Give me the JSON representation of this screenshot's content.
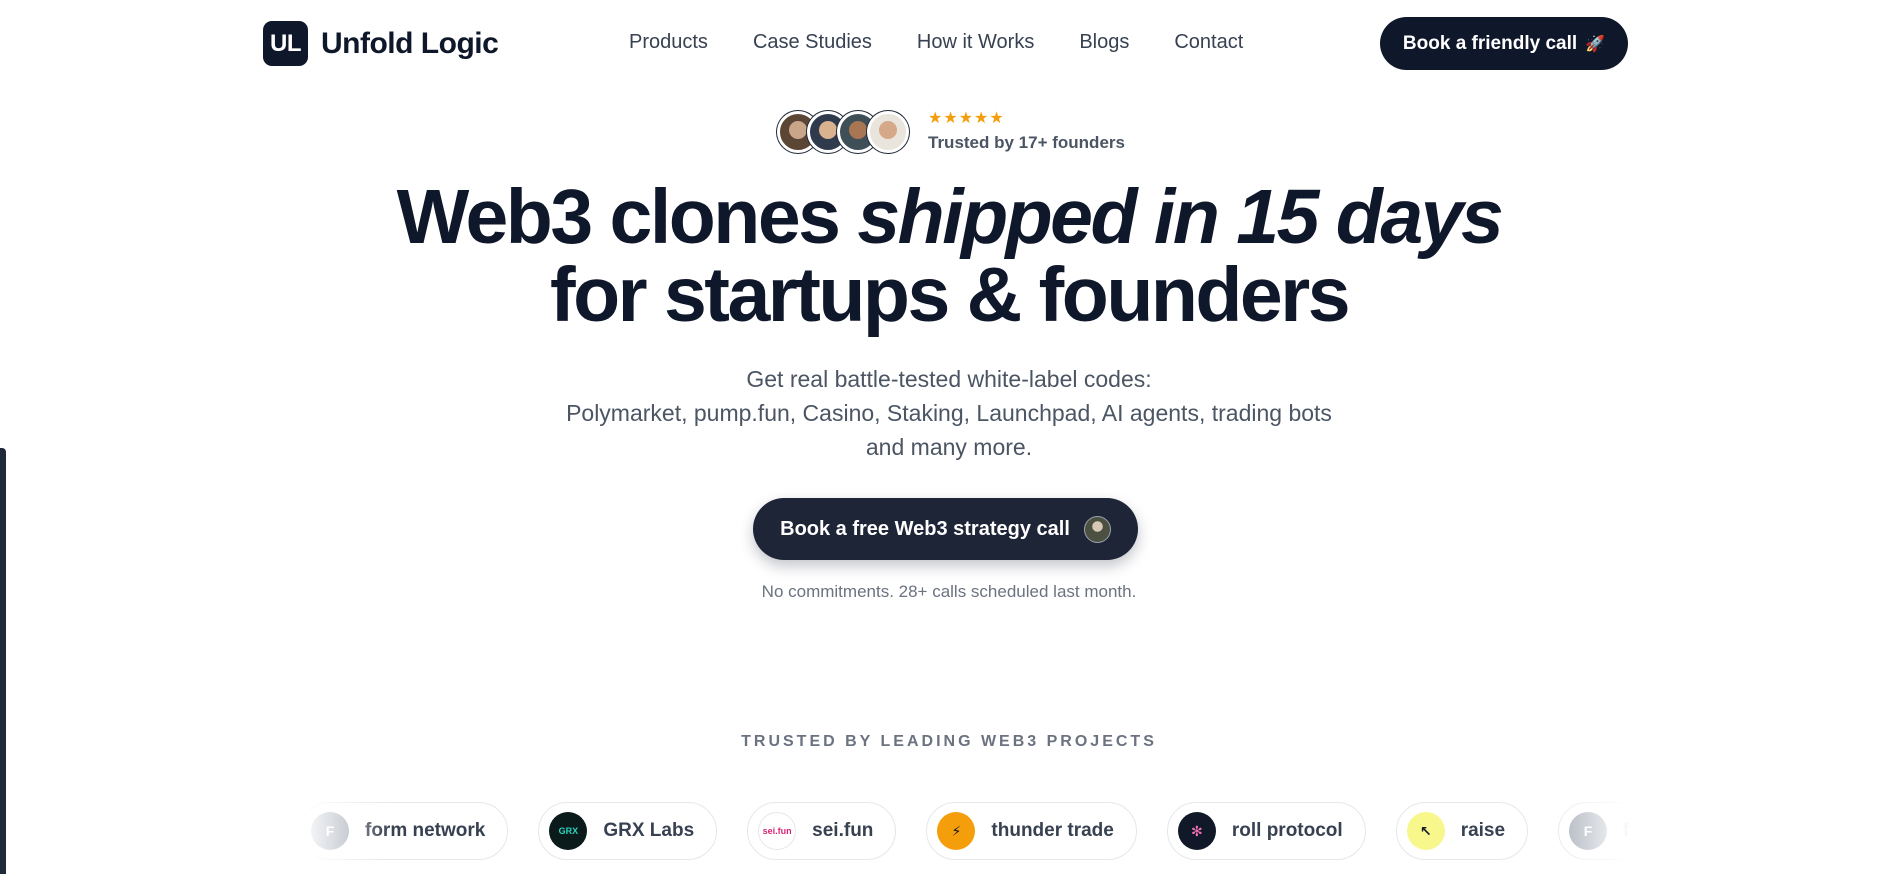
{
  "header": {
    "logo_mark": "UL",
    "brand": "Unfold Logic",
    "menu": [
      "Products",
      "Case Studies",
      "How it Works",
      "Blogs",
      "Contact"
    ],
    "cta": "Book a friendly call",
    "cta_icon": "🚀"
  },
  "trust": {
    "stars": "★★★★★",
    "label": "Trusted by 17+ founders",
    "avatar_count": 4
  },
  "hero": {
    "title_part1": "Web3 clones ",
    "title_italic": "shipped in 15 days",
    "title_line2": "for startups & founders",
    "subtitle_line1": "Get real battle-tested white-label codes:",
    "subtitle_line2": "Polymarket, pump.fun, Casino, Staking, Launchpad, AI agents, trading bots",
    "subtitle_line3": "and many more.",
    "cta": "Book a free Web3 strategy call",
    "note": "No commitments. 28+ calls scheduled last month."
  },
  "trusted_by": {
    "heading": "TRUSTED BY LEADING WEB3 PROJECTS",
    "logos": [
      {
        "name": "form network",
        "icon": "form-logo",
        "bg": "#9ca3af",
        "fg": "#ffffff",
        "mark": "F"
      },
      {
        "name": "GRX Labs",
        "icon": "grx-logo",
        "bg": "#0b1a1a",
        "fg": "#2dd4bf",
        "mark": "GRX"
      },
      {
        "name": "sei.fun",
        "icon": "seifun-logo",
        "bg": "#ffffff",
        "fg": "#db2777",
        "mark": "sei.fun"
      },
      {
        "name": "thunder trade",
        "icon": "thunder-logo",
        "bg": "#f59e0b",
        "fg": "#111827",
        "mark": "⚡"
      },
      {
        "name": "roll protocol",
        "icon": "roll-logo",
        "bg": "#111827",
        "fg": "#f472b6",
        "mark": "✻"
      },
      {
        "name": "raise",
        "icon": "raise-logo",
        "bg": "#f7f78c",
        "fg": "#111827",
        "mark": "↖"
      },
      {
        "name": "form network",
        "icon": "form-logo",
        "bg": "#9ca3af",
        "fg": "#ffffff",
        "mark": "F"
      }
    ]
  }
}
